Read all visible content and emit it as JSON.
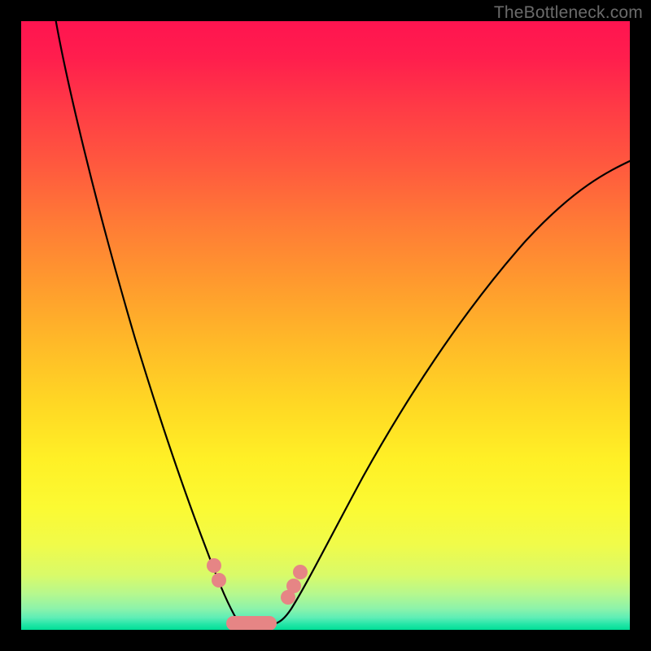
{
  "watermark": "TheBottleneck.com",
  "colors": {
    "background_frame": "#000000",
    "gradient_top": "#ff1450",
    "gradient_mid": "#ffd824",
    "gradient_bottom": "#00df97",
    "curve": "#000000",
    "marker": "#e68585"
  },
  "chart_data": {
    "type": "line",
    "title": "",
    "xlabel": "",
    "ylabel": "",
    "xlim": [
      0,
      100
    ],
    "ylim": [
      0,
      100
    ],
    "series": [
      {
        "name": "left-curve",
        "x": [
          5,
          8,
          12,
          16,
          20,
          24,
          27,
          29,
          31,
          33,
          35
        ],
        "y": [
          100,
          88,
          72,
          56,
          42,
          29,
          19,
          12,
          7,
          3,
          1
        ]
      },
      {
        "name": "right-curve",
        "x": [
          42,
          44,
          47,
          51,
          56,
          62,
          69,
          77,
          86,
          95,
          100
        ],
        "y": [
          1,
          3,
          7,
          13,
          21,
          30,
          40,
          51,
          62,
          72,
          77
        ]
      },
      {
        "name": "valley-floor",
        "x": [
          35,
          38,
          40,
          42
        ],
        "y": [
          1,
          0.5,
          0.5,
          1
        ]
      }
    ],
    "markers": [
      {
        "series": "left-curve",
        "x": 30.5,
        "y": 9.5
      },
      {
        "series": "left-curve",
        "x": 31.2,
        "y": 7.0
      },
      {
        "series": "right-curve",
        "x": 43.5,
        "y": 7.5
      },
      {
        "series": "right-curve",
        "x": 44.2,
        "y": 5.5
      },
      {
        "series": "right-curve",
        "x": 45.0,
        "y": 4.0
      }
    ],
    "valley_band": {
      "x_start": 33.5,
      "x_end": 41.5,
      "y": 1.2
    },
    "annotations": []
  }
}
